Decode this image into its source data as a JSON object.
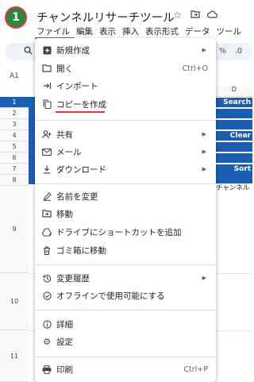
{
  "header": {
    "step_number": "1",
    "doc_title": "チャンネルリサーチツール",
    "icons": [
      "star-icon",
      "folder-move-icon",
      "cloud-status-icon"
    ]
  },
  "menubar": {
    "items": [
      "ファイル",
      "編集",
      "表示",
      "挿入",
      "表示形式",
      "データ",
      "ツール"
    ]
  },
  "toolbar": {
    "search_icon": "search-icon",
    "percent": "%",
    "decimal": ".0"
  },
  "sheet": {
    "name_box": "A1",
    "column_d": "D",
    "rows": [
      "1",
      "2",
      "3",
      "4",
      "5",
      "6",
      "7",
      "8",
      "9",
      "10",
      "11"
    ],
    "cells": {
      "d1": "Search",
      "d3": "Clear",
      "d6": "Sort",
      "d8": "チャンネル"
    }
  },
  "file_menu": {
    "items": [
      {
        "label": "新規作成",
        "icon": "new-sheet-icon",
        "submenu": true
      },
      {
        "label": "開く",
        "icon": "folder-open-icon",
        "shortcut": "Ctrl+O"
      },
      {
        "label": "インポート",
        "icon": "import-icon"
      },
      {
        "label": "コピーを作成",
        "icon": "copy-icon"
      },
      {
        "label": "共有",
        "icon": "share-person-icon",
        "submenu": true
      },
      {
        "label": "メール",
        "icon": "mail-icon",
        "submenu": true
      },
      {
        "label": "ダウンロード",
        "icon": "download-icon",
        "submenu": true
      },
      {
        "label": "名前を変更",
        "icon": "rename-icon"
      },
      {
        "label": "移動",
        "icon": "move-icon"
      },
      {
        "label": "ドライブにショートカットを追加",
        "icon": "drive-shortcut-icon"
      },
      {
        "label": "ゴミ箱に移動",
        "icon": "trash-icon"
      },
      {
        "label": "変更履歴",
        "icon": "history-icon",
        "submenu": true
      },
      {
        "label": "オフラインで使用可能にする",
        "icon": "offline-icon"
      },
      {
        "label": "詳細",
        "icon": "info-icon"
      },
      {
        "label": "設定",
        "icon": "settings-gear-icon"
      },
      {
        "label": "印刷",
        "icon": "print-icon",
        "shortcut": "Ctrl+P"
      }
    ]
  },
  "colors": {
    "accent_blue": "#1a5fb4",
    "highlight_red": "#e53935",
    "badge_green": "#2e8540"
  }
}
